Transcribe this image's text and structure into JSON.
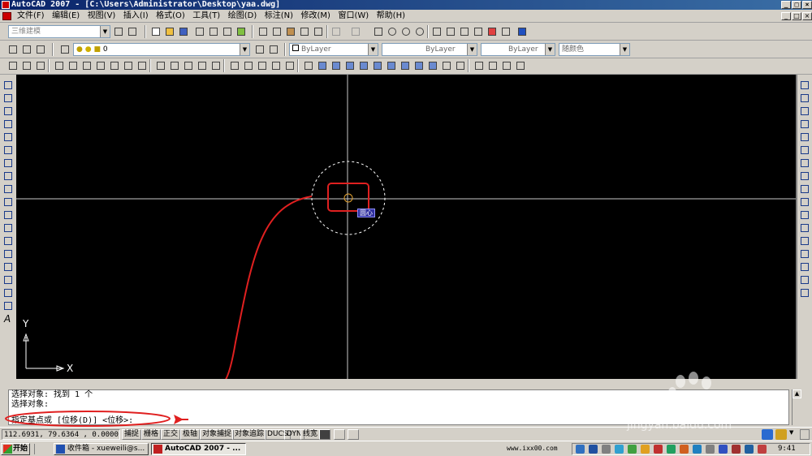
{
  "window": {
    "title": "AutoCAD 2007 - [C:\\Users\\Administrator\\Desktop\\yaa.dwg]"
  },
  "menu": [
    "文件(F)",
    "编辑(E)",
    "视图(V)",
    "插入(I)",
    "格式(O)",
    "工具(T)",
    "绘图(D)",
    "标注(N)",
    "修改(M)",
    "窗口(W)",
    "帮助(H)"
  ],
  "toolbar": {
    "workspace": "三维建模",
    "layer": "0",
    "color": "ByLayer",
    "linetype": "ByLayer",
    "lineweight": "ByLayer",
    "plotstyle": "随颜色"
  },
  "canvas": {
    "snap_tooltip": "圆心",
    "ucs_y": "Y",
    "ucs_x": "X"
  },
  "command": {
    "lines": [
      "选择对象: 找到 1 个",
      "选择对象:"
    ],
    "prompt": "指定基点或 [位移(D)] <位移>:"
  },
  "status": {
    "coords": "112.6931, 79.6364 , 0.0000",
    "toggles": [
      "捕捉",
      "栅格",
      "正交",
      "极轴",
      "对象捕捉",
      "对象追踪",
      "DUCS",
      "DYN",
      "线宽"
    ]
  },
  "taskbar": {
    "start": "开始",
    "tasks": [
      "收件箱 - xueweili@s...",
      "AutoCAD 2007 - ..."
    ],
    "tray_url": "www.ixx00.com",
    "clock": "9:41"
  },
  "watermark": {
    "logo": "Baidu经验",
    "url": "jingyan.baidu.com"
  },
  "colors": {
    "title_start": "#0a246a",
    "title_end": "#3a6ea5",
    "canvas": "#000000",
    "annotation": "#e02020",
    "tooltip_bg": "#3030a0"
  }
}
